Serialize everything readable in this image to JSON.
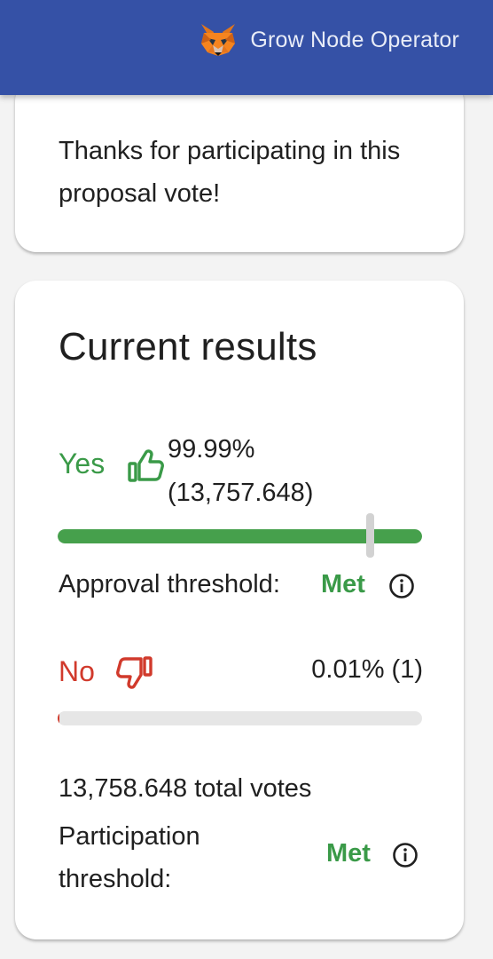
{
  "header": {
    "account_name": "Grow Node Operator",
    "background_color": "#3551a6",
    "account_icon": "metamask-fox-icon"
  },
  "thanks_card": {
    "message": "Thanks for participating in this proposal vote!"
  },
  "results": {
    "title": "Current results",
    "yes": {
      "label": "Yes",
      "icon": "thumbs-up-icon",
      "value": "99.99%\n(13,757.648)",
      "percent": 99.99,
      "color": "#46a04c"
    },
    "approval_threshold": {
      "label": "Approval threshold:",
      "status": "Met",
      "icon": "info-icon",
      "marker_fraction": 0.75
    },
    "no": {
      "label": "No",
      "icon": "thumbs-down-icon",
      "value": "0.01% (1)",
      "percent": 0.01,
      "color": "#d13a2c"
    },
    "total_votes": "13,758.648 total votes",
    "participation_threshold": {
      "label": "Participation threshold:",
      "status": "Met",
      "icon": "info-icon"
    },
    "status_color": "#3a9a48"
  }
}
